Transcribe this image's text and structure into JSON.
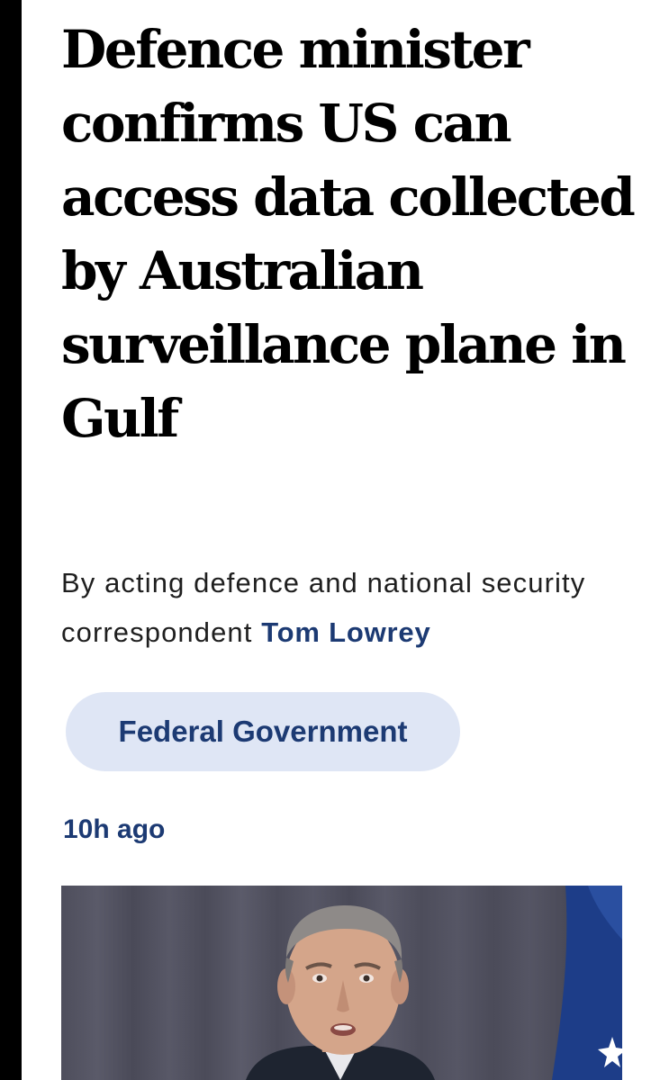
{
  "article": {
    "headline": "Defence minister confirms US can access data collected by Australian surveillance plane in Gulf",
    "byline_prefix": "By acting defence and national security correspondent",
    "author": "Tom Lowrey",
    "topic": "Federal Government",
    "timestamp": "10h ago"
  },
  "hero_image": {
    "description_icon": "photo-of-man-in-suit-speaking-with-flag"
  },
  "colors": {
    "accent": "#1c3a73",
    "pill_background": "#dfe6f5",
    "text": "#000000"
  }
}
